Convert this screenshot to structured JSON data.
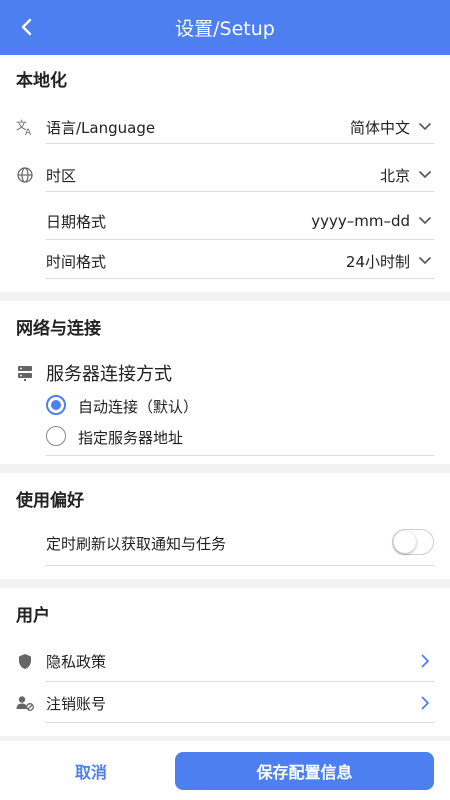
{
  "header": {
    "title": "设置/Setup"
  },
  "localization": {
    "title": "本地化",
    "language": {
      "label": "语言/Language",
      "value": "简体中文"
    },
    "timezone": {
      "label": "时区",
      "value": "北京"
    },
    "date_format": {
      "label": "日期格式",
      "value": "yyyy–mm–dd"
    },
    "time_format": {
      "label": "时间格式",
      "value": "24小时制"
    }
  },
  "network": {
    "title": "网络与连接",
    "server_method_label": "服务器连接方式",
    "options": [
      {
        "label": "自动连接（默认）",
        "selected": true
      },
      {
        "label": "指定服务器地址",
        "selected": false
      }
    ]
  },
  "preferences": {
    "title": "使用偏好",
    "auto_refresh_label": "定时刷新以获取通知与任务",
    "auto_refresh_on": false
  },
  "user": {
    "title": "用户",
    "privacy_label": "隐私政策",
    "deregister_label": "注销账号"
  },
  "footer": {
    "cancel_label": "取消",
    "save_label": "保存配置信息"
  },
  "colors": {
    "accent": "#4e7ff0"
  }
}
